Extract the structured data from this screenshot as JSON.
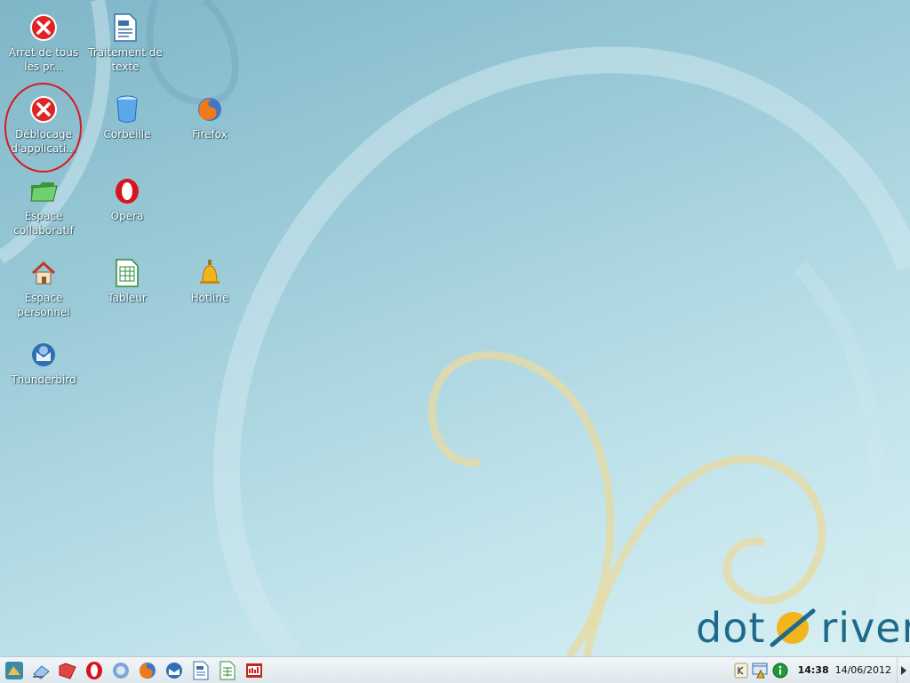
{
  "desktop": {
    "icons": [
      {
        "label": "Arret de tous les pr...",
        "icon": "stop-icon"
      },
      {
        "label": "Traitement de texte",
        "icon": "writer-icon"
      },
      {
        "label": "Déblocage d'applicati...",
        "icon": "stop-icon"
      },
      {
        "label": "Corbeille",
        "icon": "trash-icon"
      },
      {
        "label": "Firefox",
        "icon": "firefox-icon"
      },
      {
        "label": "Espace collaboratif",
        "icon": "folder-icon"
      },
      {
        "label": "Opera",
        "icon": "opera-icon"
      },
      {
        "label": "Espace personnel",
        "icon": "home-icon"
      },
      {
        "label": "Tableur",
        "icon": "spreadsheet-icon"
      },
      {
        "label": "Hotline",
        "icon": "bell-icon"
      },
      {
        "label": "Thunderbird",
        "icon": "thunderbird-icon"
      }
    ],
    "highlight_color": "#d71920"
  },
  "logo": {
    "left": "dot",
    "right": "river"
  },
  "taskbar": {
    "launchers": [
      "start-menu-icon",
      "desktop-icon",
      "folder-icon",
      "opera-icon",
      "thunderbird-icon",
      "firefox-icon",
      "thunderbird-icon",
      "writer-icon",
      "spreadsheet-icon",
      "presentation-icon"
    ],
    "clock_time": "14:38",
    "clock_date": "14/06/2012",
    "tray": [
      "keyboard-icon",
      "network-icon",
      "info-icon"
    ]
  },
  "colors": {
    "text": "#ffffff",
    "brand": "#1d6a8c",
    "swirl": "#e8d9a0"
  }
}
